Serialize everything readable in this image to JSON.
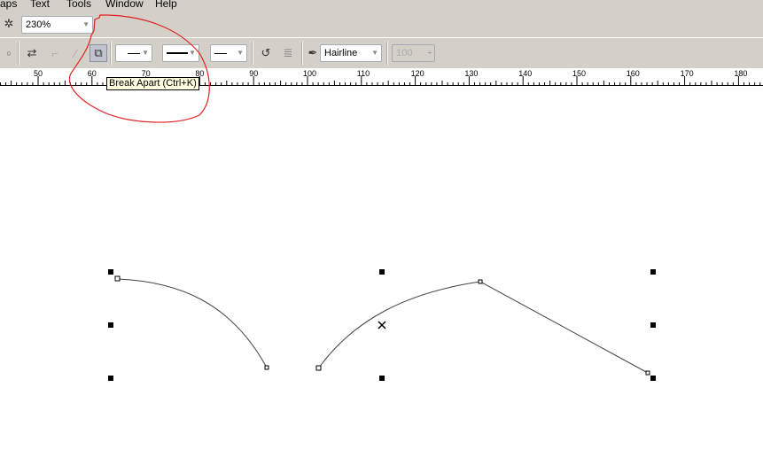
{
  "menu": [
    "aps",
    "Text",
    "Tools",
    "Window",
    "Help"
  ],
  "zoom": {
    "value": "230%"
  },
  "property_bar": {
    "outline_width": "Hairline",
    "opacity": "100"
  },
  "tooltip": "Break Apart (Ctrl+K)",
  "ruler": {
    "labels": [
      "50",
      "60",
      "70",
      "80",
      "90",
      "100",
      "110",
      "120",
      "130",
      "140",
      "150",
      "160",
      "170",
      "180"
    ]
  },
  "colors": {
    "annotation": "#e02020",
    "toolbar": "#d4d0c8"
  }
}
